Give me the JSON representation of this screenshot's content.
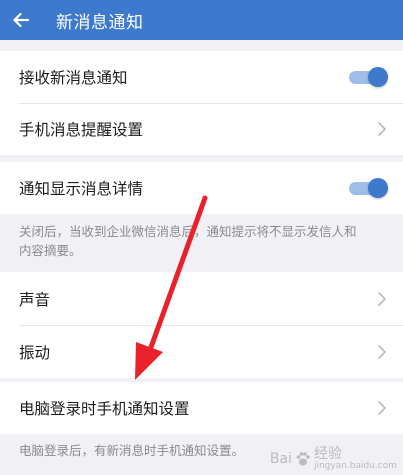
{
  "header": {
    "title": "新消息通知"
  },
  "group1": {
    "receive_label": "接收新消息通知",
    "receive_on": true,
    "phone_remind_label": "手机消息提醒设置"
  },
  "group2": {
    "show_detail_label": "通知显示消息详情",
    "show_detail_on": true,
    "note_line1": "关闭后，当收到企业微信消息后，通知提示将不显示发信人和",
    "note_line2": "内容摘要。"
  },
  "group3": {
    "sound_label": "声音",
    "vibrate_label": "振动"
  },
  "group4": {
    "pc_login_label": "电脑登录时手机通知设置",
    "note": "电脑登录后，有新消息时手机通知设置。"
  },
  "watermark": {
    "brand": "Bai",
    "brand2": "经验",
    "url": "jingyan.baidu.com"
  },
  "colors": {
    "accent": "#3d79cc",
    "background": "#f0f0f5",
    "annotation_arrow": "#e8212a"
  }
}
